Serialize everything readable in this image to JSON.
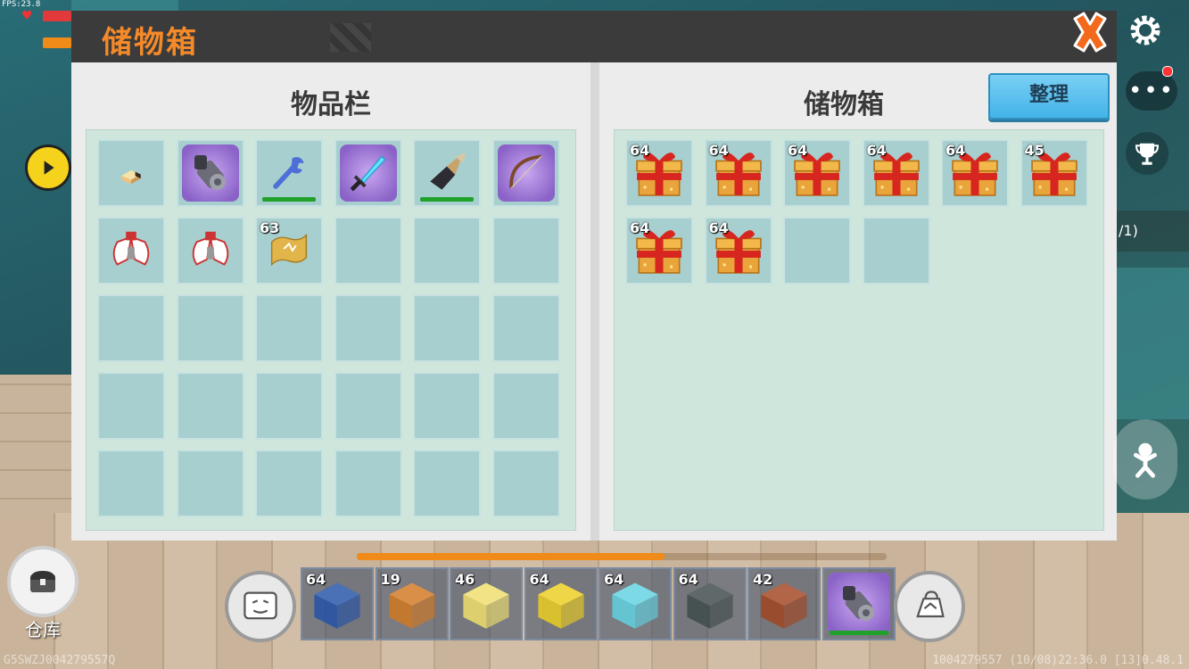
{
  "hud": {
    "fps": "FPS:23.8"
  },
  "panel": {
    "title": "储物箱"
  },
  "inventory": {
    "title": "物品栏",
    "slots": [
      {
        "item": "block-item",
        "count": ""
      },
      {
        "item": "purple-drill",
        "count": ""
      },
      {
        "item": "wrench",
        "count": ""
      },
      {
        "item": "crystal-sword",
        "count": ""
      },
      {
        "item": "shovel",
        "count": ""
      },
      {
        "item": "bow",
        "count": ""
      },
      {
        "item": "wings-armor",
        "count": ""
      },
      {
        "item": "wings-armor",
        "count": ""
      },
      {
        "item": "scroll",
        "count": "63"
      }
    ]
  },
  "storage": {
    "title": "储物箱",
    "sort_label": "整理",
    "slots": [
      {
        "item": "gift-box",
        "count": "64"
      },
      {
        "item": "gift-box",
        "count": "64"
      },
      {
        "item": "gift-box",
        "count": "64"
      },
      {
        "item": "gift-box",
        "count": "64"
      },
      {
        "item": "gift-box",
        "count": "64"
      },
      {
        "item": "gift-box",
        "count": "45"
      },
      {
        "item": "gift-box",
        "count": "64"
      },
      {
        "item": "gift-box",
        "count": "64"
      },
      {
        "item": "",
        "count": ""
      },
      {
        "item": "",
        "count": ""
      }
    ]
  },
  "side": {
    "count_text": "/1)"
  },
  "warehouse": {
    "label": "仓库"
  },
  "hotbar": {
    "progress": 0.58,
    "slots": [
      {
        "item": "blue-star-block",
        "count": "64",
        "color": "#1f4fa8"
      },
      {
        "item": "amber-block",
        "count": "19",
        "color": "#d6771a"
      },
      {
        "item": "glow-block",
        "count": "46",
        "color": "#f7e56a"
      },
      {
        "item": "yellow-block",
        "count": "64",
        "color": "#f2d21a"
      },
      {
        "item": "ice-block",
        "count": "64",
        "color": "#5fd6e6"
      },
      {
        "item": "dark-block",
        "count": "64",
        "color": "#3b4746"
      },
      {
        "item": "lava-block",
        "count": "42",
        "color": "#a3421a"
      },
      {
        "item": "purple-drill",
        "count": "",
        "color": "#8b63c8"
      }
    ]
  },
  "ids": {
    "left": "G5SWZJ004279557Q",
    "right": "1004279557  (10/08)22:36.0  [13]0.48.1"
  }
}
